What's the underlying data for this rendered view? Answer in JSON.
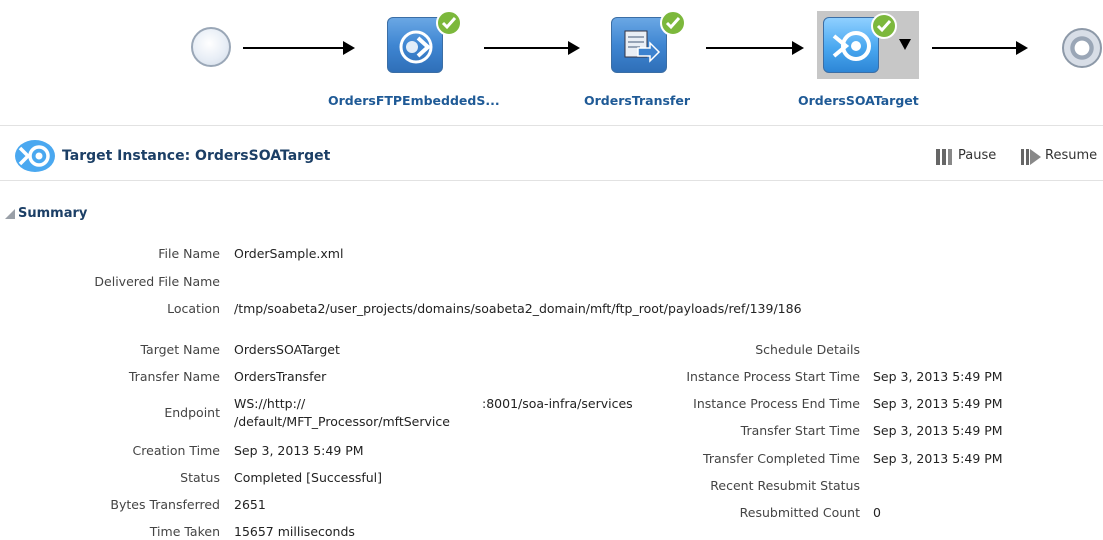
{
  "flow": {
    "nodes": [
      {
        "label": "OrdersFTPEmbeddedS...",
        "status": "success",
        "icon": "ftp-source-icon"
      },
      {
        "label": "OrdersTransfer",
        "status": "success",
        "icon": "transfer-icon"
      },
      {
        "label": "OrdersSOATarget",
        "status": "success",
        "icon": "soa-target-icon",
        "selected": true
      }
    ]
  },
  "header": {
    "title": "Target Instance: OrdersSOATarget",
    "pause_label": "Pause",
    "resume_label": "Resume"
  },
  "summary": {
    "heading": "Summary",
    "left": [
      {
        "label": "File Name",
        "value": "OrderSample.xml"
      },
      {
        "label": "Delivered File Name",
        "value": ""
      },
      {
        "label": "Location",
        "value": "/tmp/soabeta2/user_projects/domains/soabeta2_domain/mft/ftp_root/payloads/ref/139/186"
      },
      {
        "label": "Target Name",
        "value": "OrdersSOATarget"
      },
      {
        "label": "Transfer Name",
        "value": "OrdersTransfer"
      },
      {
        "label": "Endpoint",
        "value_line1a": "WS://http://",
        "value_line1b": ":8001/soa-infra/services",
        "value_line2": "/default/MFT_Processor/mftService"
      },
      {
        "label": "Creation Time",
        "value": "Sep 3, 2013 5:49 PM"
      },
      {
        "label": "Status",
        "value": "Completed [Successful]"
      },
      {
        "label": "Bytes Transferred",
        "value": "2651"
      },
      {
        "label": "Time Taken",
        "value": "15657 milliseconds"
      }
    ],
    "right": [
      {
        "label": "Schedule Details",
        "value": ""
      },
      {
        "label": "Instance Process Start Time",
        "value": "Sep 3, 2013 5:49 PM"
      },
      {
        "label": "Instance Process End Time",
        "value": "Sep 3, 2013 5:49 PM"
      },
      {
        "label": "Transfer Start Time",
        "value": "Sep 3, 2013 5:49 PM"
      },
      {
        "label": "Transfer Completed Time",
        "value": "Sep 3, 2013 5:49 PM"
      },
      {
        "label": "Recent Resubmit Status",
        "value": ""
      },
      {
        "label": "Resubmitted Count",
        "value": "0"
      }
    ]
  },
  "colors": {
    "accent": "#1f5a96",
    "success": "#7cb83c",
    "node_blue": "#3f86d2"
  }
}
